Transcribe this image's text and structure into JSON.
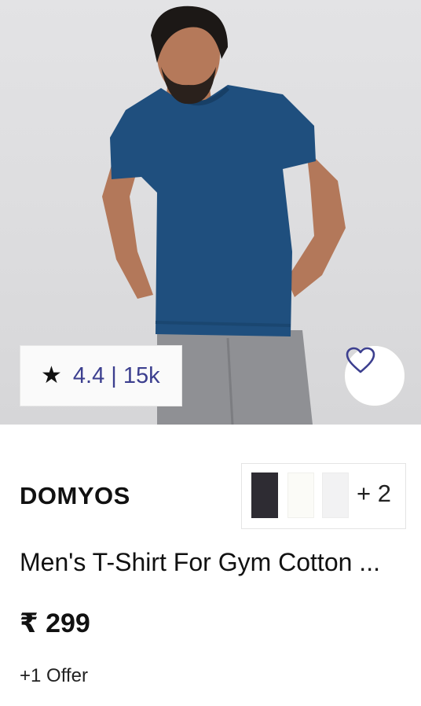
{
  "product": {
    "rating_icon": "star-icon",
    "rating": "4.4 | 15k",
    "wishlist_icon": "heart-icon",
    "brand": "DOMYOS",
    "swatches": [
      "#2e2c33",
      "#fbfbf7",
      "#f2f2f3"
    ],
    "more_colors": "+ 2",
    "title": "Men's T-Shirt For Gym Cotton ...",
    "price": "₹ 299",
    "offer": "+1 Offer"
  },
  "colors": {
    "accent": "#3c3f8f",
    "shirt": "#1f4f7e",
    "pants": "#8f9094"
  }
}
